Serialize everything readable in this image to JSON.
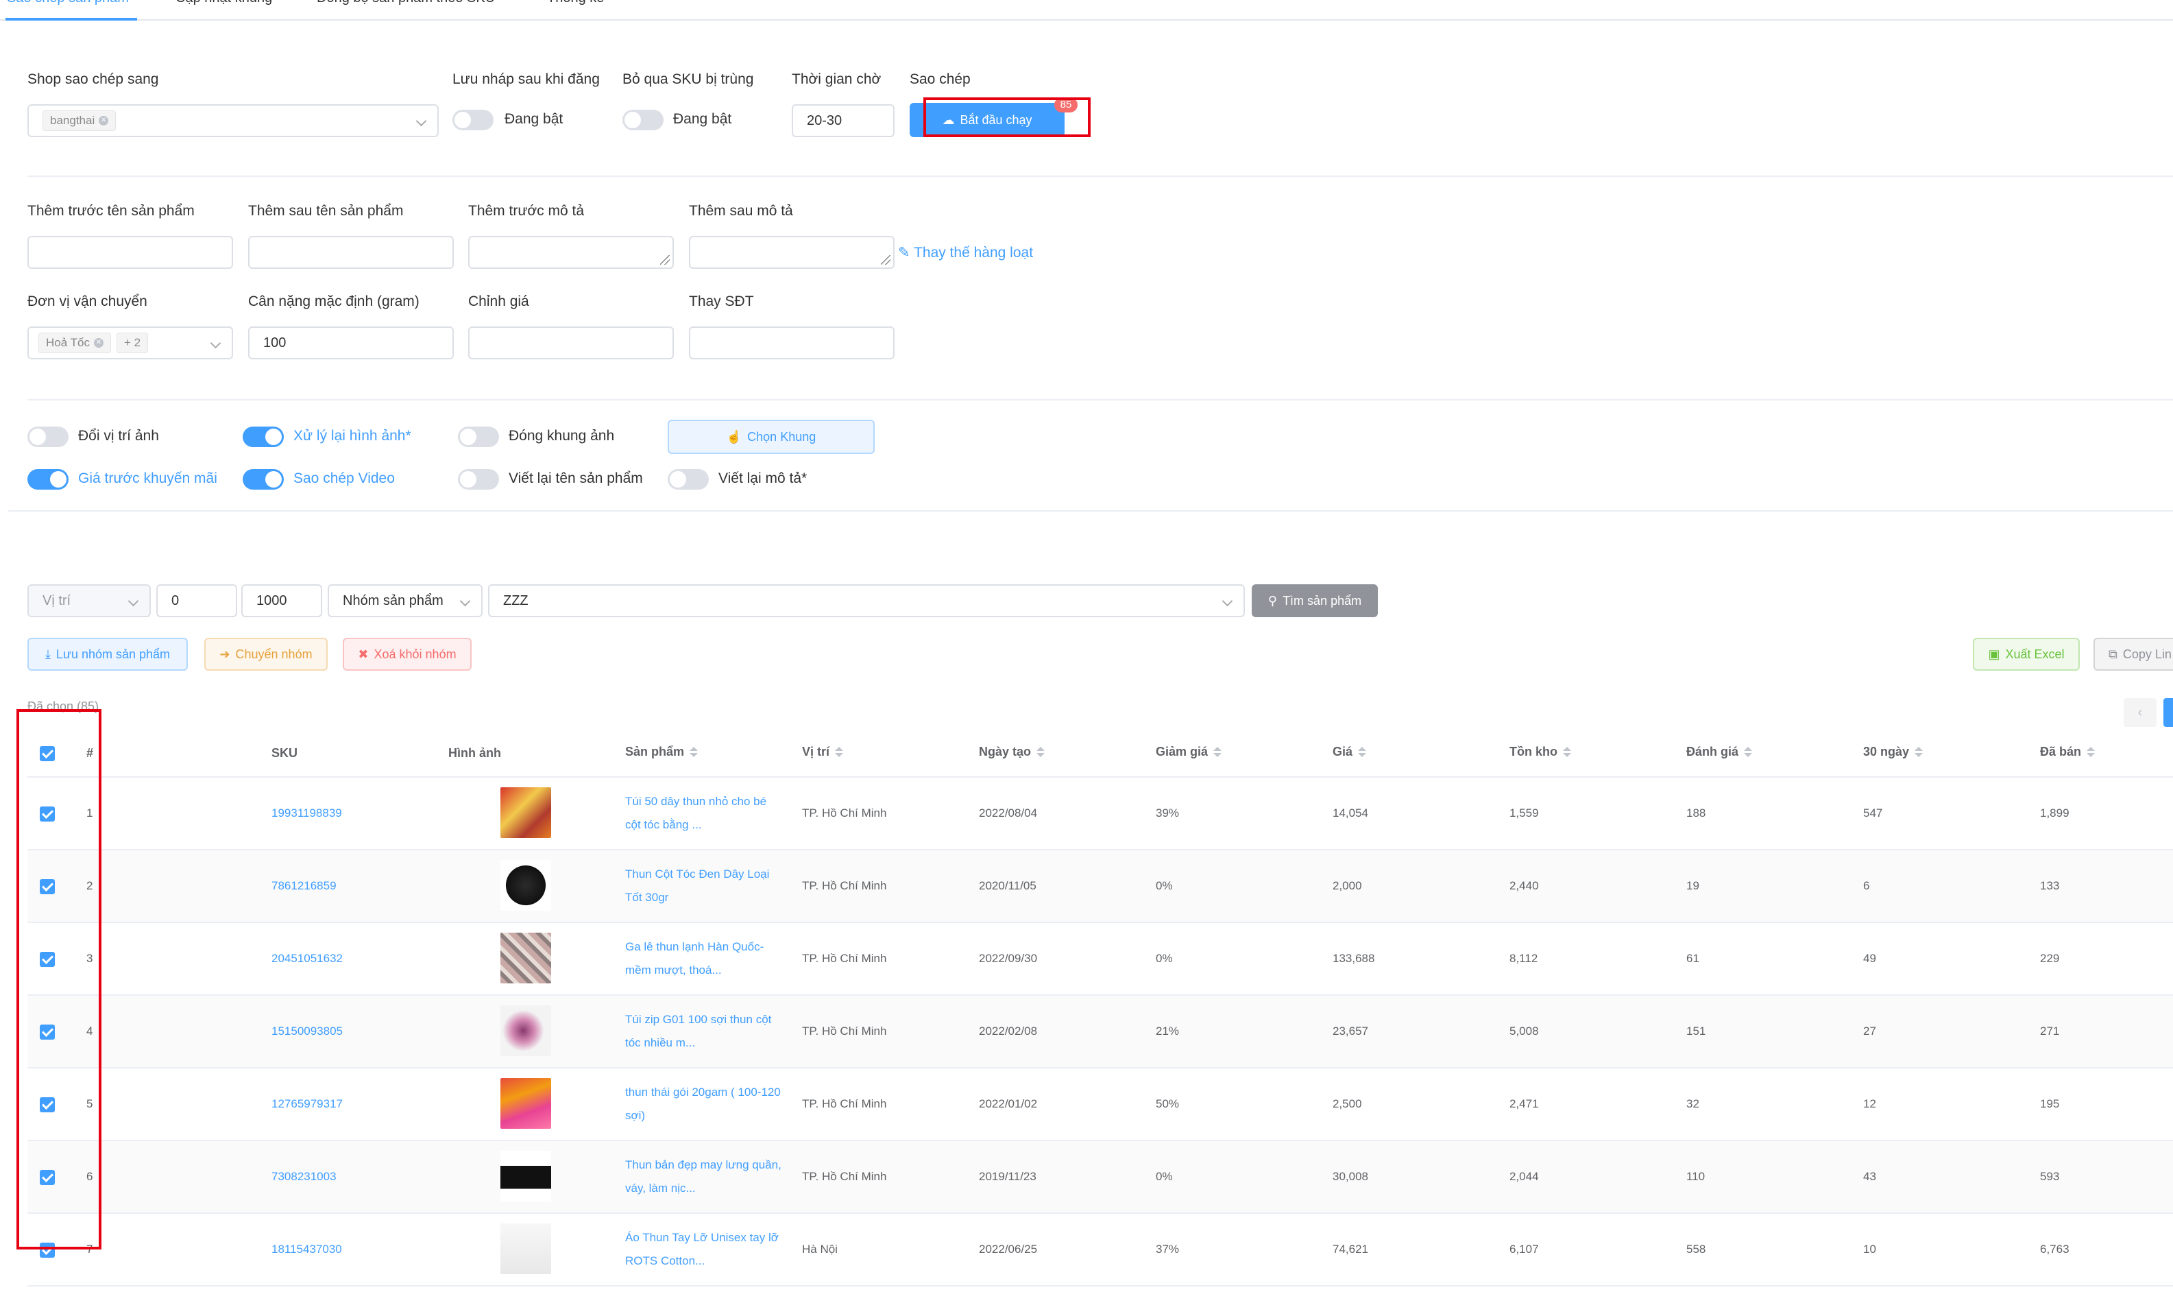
{
  "tabs": [
    {
      "label": "Sao chép sản phẩm",
      "active": true
    },
    {
      "label": "Cập nhật khung",
      "active": false
    },
    {
      "label": "Đồng bộ sản phẩm theo SKU",
      "active": false
    },
    {
      "label": "Thống kê",
      "active": false
    }
  ],
  "copy_settings": {
    "shop_label": "Shop sao chép sang",
    "shop_tag": "bangthai",
    "draft_label": "Lưu nháp sau khi đăng",
    "draft_state": "Đang bật",
    "skip_sku_label": "Bỏ qua SKU bị trùng",
    "skip_sku_state": "Đang bật",
    "wait_label": "Thời gian chờ",
    "wait_value": "20-30",
    "copy_label": "Sao chép",
    "start_button": "Bắt đầu chạy",
    "start_badge": "85"
  },
  "edit_fields": {
    "prefix_name_label": "Thêm trước tên sản phẩm",
    "suffix_name_label": "Thêm sau tên sản phẩm",
    "prefix_desc_label": "Thêm trước mô tả",
    "suffix_desc_label": "Thêm sau mô tả",
    "replace_link": "Thay thế hàng loạt",
    "shipping_label": "Đơn vị vận chuyển",
    "shipping_tag": "Hoả Tốc",
    "shipping_more": "+ 2",
    "weight_label": "Cân nặng mặc định (gram)",
    "weight_value": "100",
    "price_adjust_label": "Chỉnh giá",
    "phone_label": "Thay SĐT"
  },
  "options": {
    "swap_image": {
      "label": "Đổi vị trí ảnh",
      "on": false
    },
    "reprocess_image": {
      "label": "Xử lý lại hình ảnh*",
      "on": true
    },
    "frame_image": {
      "label": "Đóng khung ảnh",
      "on": false
    },
    "choose_frame_button": "Chọn Khung",
    "promo_price": {
      "label": "Giá trước khuyến mãi",
      "on": true
    },
    "copy_video": {
      "label": "Sao chép Video",
      "on": true
    },
    "rewrite_name": {
      "label": "Viết lại tên sản phẩm",
      "on": false
    },
    "rewrite_desc": {
      "label": "Viết lại mô tả*",
      "on": false
    }
  },
  "filters": {
    "position_placeholder": "Vị trí",
    "from_value": "0",
    "to_value": "1000",
    "group_select": "Nhóm sản phẩm",
    "keyword_value": "ZZZ",
    "search_button": "Tìm sản phẩm"
  },
  "actions": {
    "save_group": "Lưu nhóm sản phẩm",
    "move_group": "Chuyển nhóm",
    "remove_group": "Xoá khỏi nhóm",
    "export_excel": "Xuất Excel",
    "copy_link": "Copy Lin"
  },
  "selected_text": "Đã chọn (85)",
  "table": {
    "headers": {
      "index": "#",
      "sku": "SKU",
      "image": "Hình ảnh",
      "product": "Sản phẩm",
      "location": "Vị trí",
      "created": "Ngày tạo",
      "discount": "Giảm giá",
      "price": "Giá",
      "stock": "Tồn kho",
      "rating": "Đánh giá",
      "d30": "30 ngày",
      "sold": "Đã bán"
    },
    "rows": [
      {
        "index": "1",
        "sku": "19931198839",
        "product": "Túi 50 dây thun nhỏ cho bé cột tóc bằng ...",
        "location": "TP. Hồ Chí Minh",
        "created": "2022/08/04",
        "discount": "39%",
        "price": "14,054",
        "stock": "1,559",
        "rating": "188",
        "d30": "547",
        "sold": "1,899"
      },
      {
        "index": "2",
        "sku": "7861216859",
        "product": "Thun Cột Tóc Đen Dây Loại Tốt 30gr",
        "location": "TP. Hồ Chí Minh",
        "created": "2020/11/05",
        "discount": "0%",
        "price": "2,000",
        "stock": "2,440",
        "rating": "19",
        "d30": "6",
        "sold": "133"
      },
      {
        "index": "3",
        "sku": "20451051632",
        "product": "Ga lê thun lạnh Hàn Quốc- mềm mượt, thoá...",
        "location": "TP. Hồ Chí Minh",
        "created": "2022/09/30",
        "discount": "0%",
        "price": "133,688",
        "stock": "8,112",
        "rating": "61",
        "d30": "49",
        "sold": "229"
      },
      {
        "index": "4",
        "sku": "15150093805",
        "product": "Túi zip G01 100 sợi thun cột tóc nhiều m...",
        "location": "TP. Hồ Chí Minh",
        "created": "2022/02/08",
        "discount": "21%",
        "price": "23,657",
        "stock": "5,008",
        "rating": "151",
        "d30": "27",
        "sold": "271"
      },
      {
        "index": "5",
        "sku": "12765979317",
        "product": "thun thái gói 20gam ( 100-120 sợi)",
        "location": "TP. Hồ Chí Minh",
        "created": "2022/01/02",
        "discount": "50%",
        "price": "2,500",
        "stock": "2,471",
        "rating": "32",
        "d30": "12",
        "sold": "195"
      },
      {
        "index": "6",
        "sku": "7308231003",
        "product": "Thun bản đẹp may lưng quần, váy, làm nịc...",
        "location": "TP. Hồ Chí Minh",
        "created": "2019/11/23",
        "discount": "0%",
        "price": "30,008",
        "stock": "2,044",
        "rating": "110",
        "d30": "43",
        "sold": "593"
      },
      {
        "index": "7",
        "sku": "18115437030",
        "product": "Áo Thun Tay Lỡ Unisex tay lỡ ROTS Cotton...",
        "location": "Hà Nội",
        "created": "2022/06/25",
        "discount": "37%",
        "price": "74,621",
        "stock": "6,107",
        "rating": "558",
        "d30": "10",
        "sold": "6,763"
      }
    ]
  },
  "colors": {
    "primary": "#409eff",
    "highlight_box": "#e60012",
    "badge": "#f56c6c"
  }
}
